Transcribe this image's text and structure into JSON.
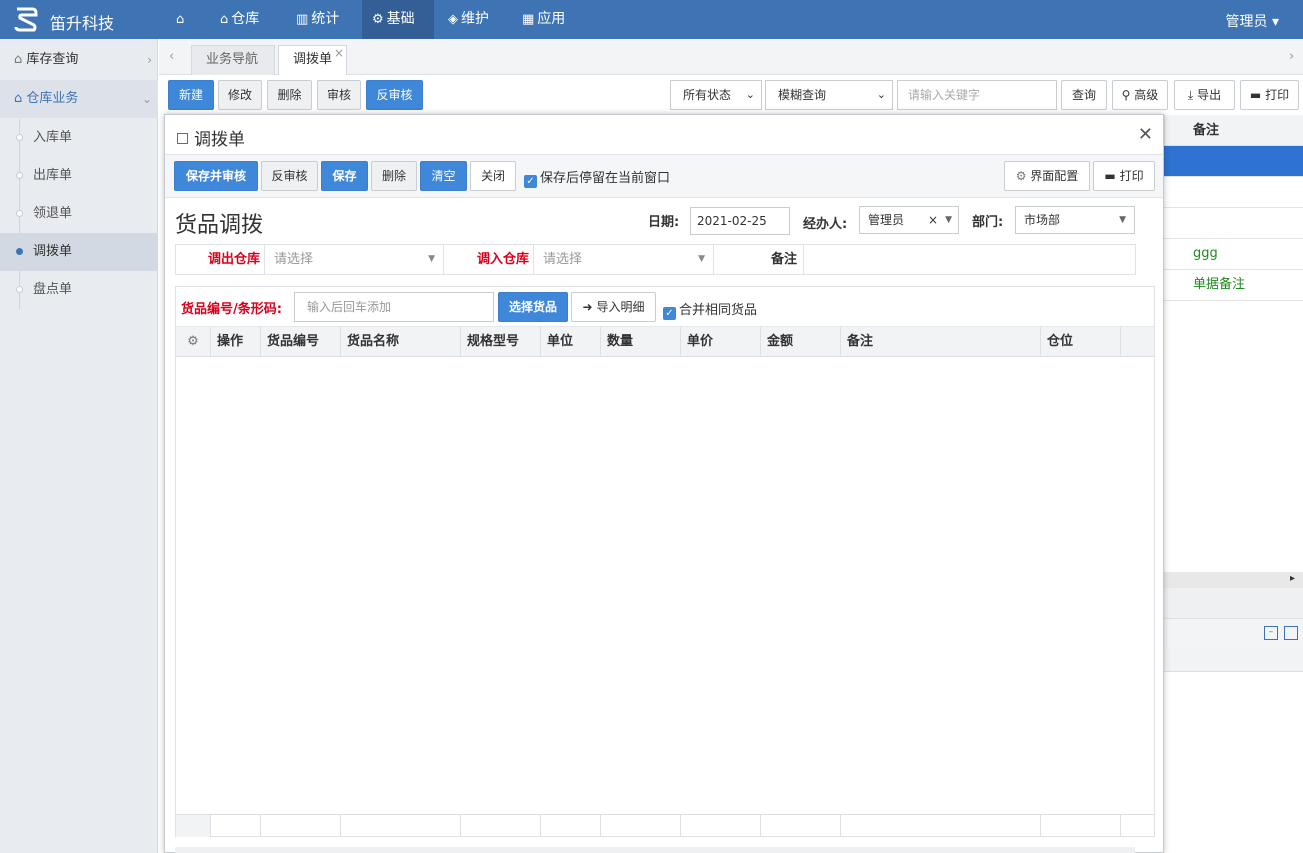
{
  "app": {
    "brand": "笛升科技",
    "user": "管理员 ▾"
  },
  "nav": [
    {
      "label": "",
      "icon": "home-icon"
    },
    {
      "label": "仓库",
      "icon": "warehouse-icon"
    },
    {
      "label": "统计",
      "icon": "chart-icon"
    },
    {
      "label": "基础",
      "icon": "gear-icon"
    },
    {
      "label": "维护",
      "icon": "shield-icon"
    },
    {
      "label": "应用",
      "icon": "grid-icon"
    }
  ],
  "sidebar": {
    "group1": "库存查询",
    "group2": "仓库业务",
    "items": [
      "入库单",
      "出库单",
      "领退单",
      "调拨单",
      "盘点单"
    ]
  },
  "tabs": {
    "nav": "业务导航",
    "current": "调拨单"
  },
  "toolbar": {
    "new": "新建",
    "edit": "修改",
    "delete": "删除",
    "audit": "审核",
    "unaudit": "反审核",
    "status_filter": "所有状态",
    "query_mode": "模糊查询",
    "keyword_placeholder": "请输入关键字",
    "query": "查询",
    "advanced": "高级",
    "export": "导出",
    "print": "打印"
  },
  "background_table": {
    "header": "备注",
    "rows": [
      "",
      "",
      "",
      "ggg",
      "单据备注"
    ]
  },
  "modal": {
    "title": "调拨单",
    "actions": {
      "save_audit": "保存并审核",
      "unaudit": "反审核",
      "save": "保存",
      "delete": "删除",
      "clear": "清空",
      "close": "关闭",
      "stay_label": "保存后停留在当前窗口",
      "ui_config": "界面配置",
      "print": "打印"
    },
    "heading": "货品调拨",
    "date_label": "日期:",
    "date_value": "2021-02-25",
    "handler_label": "经办人:",
    "handler_value": "管理员",
    "dept_label": "部门:",
    "dept_value": "市场部",
    "out_wh_label": "调出仓库",
    "out_wh_placeholder": "请选择",
    "in_wh_label": "调入仓库",
    "in_wh_placeholder": "请选择",
    "remark_label": "备注",
    "scan_label": "货品编号/条形码:",
    "scan_placeholder": "输入后回车添加",
    "select_goods": "选择货品",
    "import_detail": "导入明细",
    "merge_label": "合并相同货品",
    "columns": [
      "操作",
      "货品编号",
      "货品名称",
      "规格型号",
      "单位",
      "数量",
      "单价",
      "金额",
      "备注",
      "仓位"
    ]
  }
}
